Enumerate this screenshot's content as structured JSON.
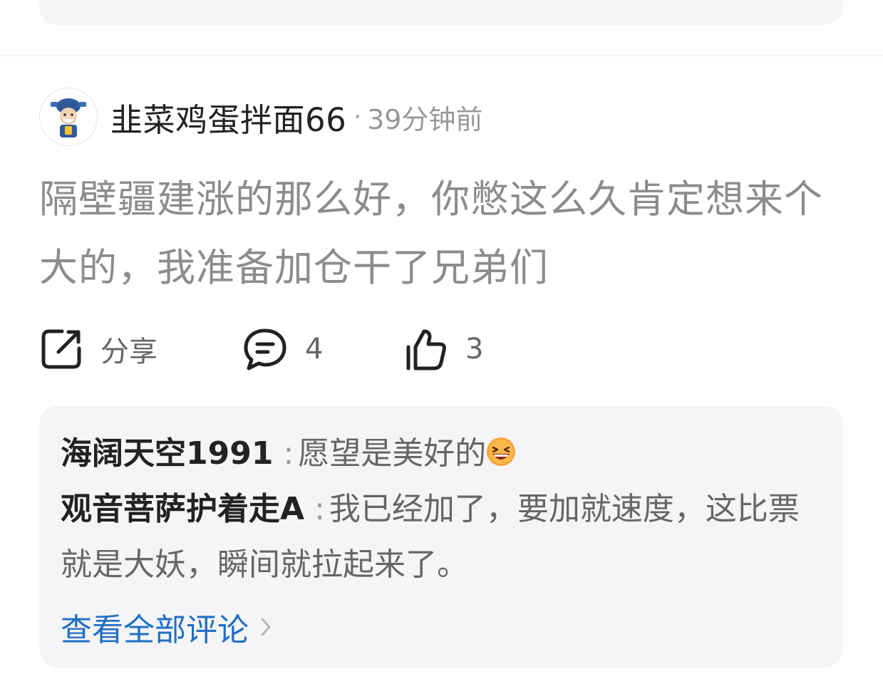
{
  "post": {
    "username": "韭菜鸡蛋拌面66",
    "separator": "·",
    "time": "39分钟前",
    "body": "隔壁疆建涨的那么好，你憋这么久肯定想来个大的，我准备加仓干了兄弟们"
  },
  "actions": {
    "share_icon": "share-icon",
    "share_label": "分享",
    "comment_icon": "comment-icon",
    "comment_count": "4",
    "like_icon": "thumbs-up-icon",
    "like_count": "3"
  },
  "comments": {
    "items": [
      {
        "author": "海阔天空1991",
        "colon": ":",
        "text": "愿望是美好的",
        "emoji": "laughing-face-emoji"
      },
      {
        "author": "观音菩萨护着走A",
        "colon": ":",
        "text": "我已经加了，要加就速度，这比票就是大妖，瞬间就拉起来了。"
      }
    ],
    "view_all": "查看全部评论"
  },
  "colors": {
    "link": "#1f6fc8",
    "muted": "#999999",
    "body_text": "#8c8c8c",
    "comment_bg": "#f5f5f7"
  }
}
